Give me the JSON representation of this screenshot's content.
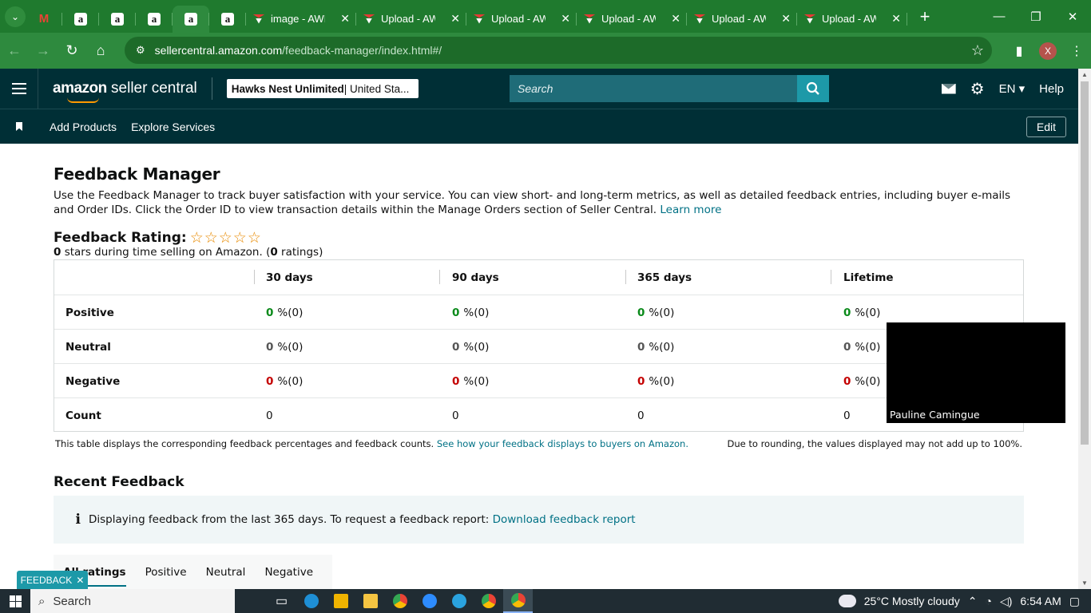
{
  "browser": {
    "tabs": [
      {
        "kind": "gmail",
        "title": ""
      },
      {
        "kind": "amazon",
        "title": ""
      },
      {
        "kind": "amazon",
        "title": ""
      },
      {
        "kind": "amazon",
        "title": ""
      },
      {
        "kind": "amazon",
        "title": "",
        "active": true
      },
      {
        "kind": "amazon",
        "title": ""
      },
      {
        "kind": "aws",
        "title": "image - AWL"
      },
      {
        "kind": "aws",
        "title": "Upload - AW"
      },
      {
        "kind": "aws",
        "title": "Upload - AW"
      },
      {
        "kind": "aws",
        "title": "Upload - AW"
      },
      {
        "kind": "aws",
        "title": "Upload - AW"
      },
      {
        "kind": "aws",
        "title": "Upload - AW"
      }
    ],
    "url_host": "sellercentral.amazon.com",
    "url_path": "/feedback-manager/index.html#/",
    "profile_initial": "X",
    "accent": "#1f7a2e"
  },
  "header": {
    "logo_bold": "amazon",
    "logo_rest": " seller central",
    "store_name": "Hawks Nest Unlimited",
    "store_region": " | United Sta...",
    "search_placeholder": "Search",
    "language": "EN",
    "help": "Help",
    "bg_color": "#002f36"
  },
  "subnav": {
    "links": [
      "Add Products",
      "Explore Services"
    ],
    "edit": "Edit"
  },
  "page": {
    "title": "Feedback Manager",
    "intro": "Use the Feedback Manager to track buyer satisfaction with your service. You can view short- and long-term metrics, as well as detailed feedback entries, including buyer e-mails and Order IDs. Click the Order ID to view transaction details within the Manage Orders section of Seller Central.",
    "learn_more": "Learn more",
    "rating_label": "Feedback Rating:",
    "stars": "☆☆☆☆☆",
    "rating_stars_value": "0",
    "rating_sub_mid": " stars during time selling on Amazon. (",
    "rating_count": "0",
    "rating_sub_end": " ratings)",
    "table": {
      "columns": [
        "30 days",
        "90 days",
        "365 days",
        "Lifetime"
      ],
      "rows": [
        {
          "label": "Positive",
          "type": "pos",
          "cells": [
            {
              "pct": "0",
              "rest": " %(0)"
            },
            {
              "pct": "0",
              "rest": " %(0)"
            },
            {
              "pct": "0",
              "rest": " %(0)"
            },
            {
              "pct": "0",
              "rest": " %(0)"
            }
          ]
        },
        {
          "label": "Neutral",
          "type": "neu",
          "cells": [
            {
              "pct": "0",
              "rest": " %(0)"
            },
            {
              "pct": "0",
              "rest": " %(0)"
            },
            {
              "pct": "0",
              "rest": " %(0)"
            },
            {
              "pct": "0",
              "rest": " %(0)"
            }
          ]
        },
        {
          "label": "Negative",
          "type": "neg",
          "cells": [
            {
              "pct": "0",
              "rest": " %(0)"
            },
            {
              "pct": "0",
              "rest": " %(0)"
            },
            {
              "pct": "0",
              "rest": " %(0)"
            },
            {
              "pct": "0",
              "rest": " %(0)"
            }
          ]
        }
      ],
      "count_label": "Count",
      "counts": [
        "0",
        "0",
        "0",
        "0"
      ]
    },
    "table_note": "This table displays the corresponding feedback percentages and feedback counts.",
    "table_note_link": "See how your feedback displays to buyers on Amazon.",
    "rounding_note": "Due to rounding, the values displayed may not add up to 100%.",
    "recent_title": "Recent Feedback",
    "info_text": "Displaying feedback from the last 365 days. To request a feedback report:",
    "info_link": "Download feedback report",
    "filter_tabs": [
      "All ratings",
      "Positive",
      "Neutral",
      "Negative"
    ]
  },
  "video_overlay": {
    "name": "Pauline Camingue"
  },
  "feedback_badge": "FEEDBACK",
  "taskbar": {
    "search": "Search",
    "weather": "25°C  Mostly cloudy",
    "time": "6:54 AM"
  }
}
